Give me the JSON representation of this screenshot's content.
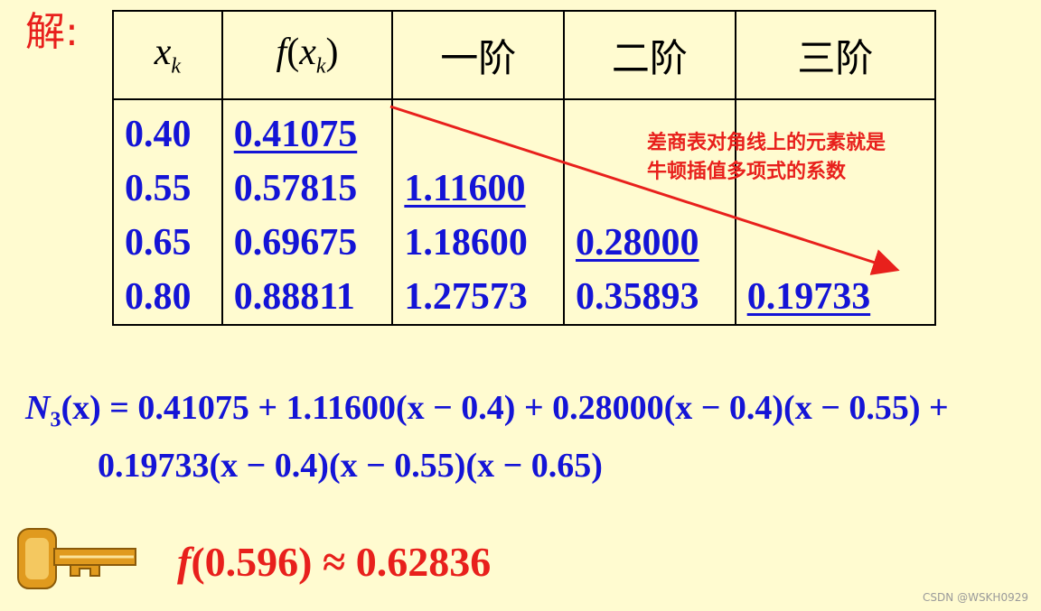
{
  "solution_label": "解:",
  "table": {
    "headers": {
      "col1": {
        "base": "x",
        "sub": "k"
      },
      "col2": {
        "f": "f",
        "open": "(",
        "base": "x",
        "sub": "k",
        "close": ")"
      },
      "col3": "一阶",
      "col4": "二阶",
      "col5": "三阶"
    },
    "x_values": [
      "0.40",
      "0.55",
      "0.65",
      "0.80"
    ],
    "f_values": [
      "0.41075",
      "0.57815",
      "0.69675",
      "0.88811"
    ],
    "first_order": [
      "1.11600",
      "1.18600",
      "1.27573"
    ],
    "second_order": [
      "0.28000",
      "0.35893"
    ],
    "third_order": [
      "0.19733"
    ]
  },
  "annotation": {
    "line1": "差商表对角线上的元素就是",
    "line2": "牛顿插值多项式的系数"
  },
  "formula": {
    "lhs_N": "N",
    "lhs_sub": "3",
    "lhs_arg": "(x) = ",
    "line1_rest": "0.41075 + 1.11600(x − 0.4) + 0.28000(x − 0.4)(x − 0.55) +",
    "line2": "0.19733(x − 0.4)(x − 0.55)(x − 0.65)"
  },
  "result": {
    "f": "f",
    "rest": "(0.596) ≈ 0.62836"
  },
  "watermark": "CSDN @WSKH0929",
  "colors": {
    "background": "#fffbd0",
    "blue": "#1414d6",
    "red": "#e8201c",
    "key": "#e09a1e"
  },
  "icons": [
    "key-icon",
    "arrow-icon"
  ]
}
